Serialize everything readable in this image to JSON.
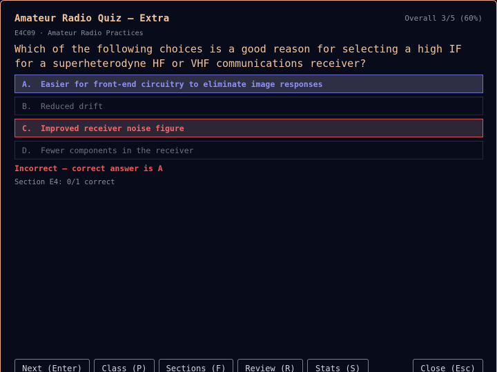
{
  "header": {
    "title": "Amateur Radio Quiz — Extra",
    "overall": "Overall 3/5 (60%)",
    "subtitle": "E4C09 · Amateur Radio Practices"
  },
  "question": {
    "text": "Which of the following choices is a good reason for selecting a high IF for a superheterodyne HF or VHF communications receiver?"
  },
  "options": [
    {
      "letter": "A.",
      "text": "Easier for front-end circuitry to eliminate image responses",
      "state": "correct"
    },
    {
      "letter": "B.",
      "text": "Reduced drift",
      "state": "neutral"
    },
    {
      "letter": "C.",
      "text": "Improved receiver noise figure",
      "state": "wrong"
    },
    {
      "letter": "D.",
      "text": "Fewer components in the receiver",
      "state": "neutral"
    }
  ],
  "feedback": {
    "result": "Incorrect — correct answer is A",
    "section_score": "Section E4: 0/1 correct"
  },
  "footer": {
    "next": "Next  (Enter)",
    "class": "Class  (P)",
    "sections": "Sections  (F)",
    "review": "Review  (R)",
    "stats": "Stats  (S)",
    "close": "Close  (Esc)"
  },
  "colors": {
    "background": "#080c1a",
    "accent": "#f3c49b",
    "correct": "#8f90f0",
    "incorrect": "#f06a6a"
  }
}
